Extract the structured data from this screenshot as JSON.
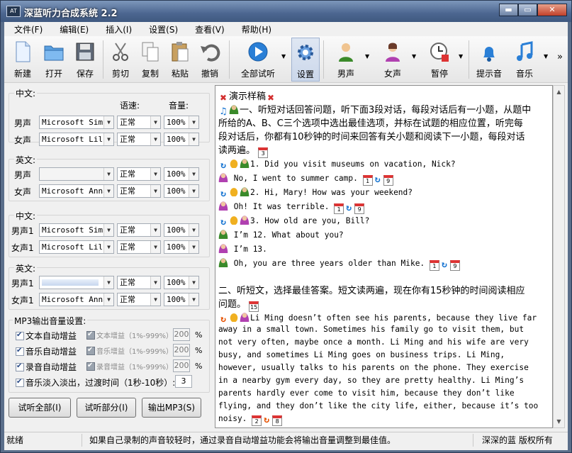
{
  "window": {
    "title": "深蓝听力合成系统 2.2",
    "min": "▬",
    "max": "▭",
    "close": "✕"
  },
  "menu": [
    "文件(F)",
    "编辑(E)",
    "插入(I)",
    "设置(S)",
    "查看(V)",
    "帮助(H)"
  ],
  "toolbar": {
    "new": "新建",
    "open": "打开",
    "save": "保存",
    "cut": "剪切",
    "copy": "复制",
    "paste": "粘贴",
    "undo": "撤销",
    "preview": "全部试听",
    "settings": "设置",
    "male": "男声",
    "female": "女声",
    "pause": "暂停",
    "cue": "提示音",
    "music": "音乐",
    "more": "»"
  },
  "voice": {
    "zh1": {
      "title": "中文:",
      "speed_head": "语速:",
      "vol_head": "音量:",
      "male_label": "男声",
      "female_label": "女声",
      "male_voice": "Microsoft Simp",
      "female_voice": "Microsoft Lili",
      "male_speed": "正常",
      "female_speed": "正常",
      "male_vol": "100%",
      "female_vol": "100%"
    },
    "en1": {
      "title": "英文:",
      "male_label": "男声",
      "female_label": "女声",
      "male_voice": "",
      "female_voice": "Microsoft Anna",
      "male_speed": "正常",
      "female_speed": "正常",
      "male_vol": "100%",
      "female_vol": "100%"
    },
    "zh2": {
      "title": "中文:",
      "male_label": "男声1",
      "female_label": "女声1",
      "male_voice": "Microsoft Simp",
      "female_voice": "Microsoft Lili",
      "male_speed": "正常",
      "female_speed": "正常",
      "male_vol": "100%",
      "female_vol": "100%"
    },
    "en2": {
      "title": "英文:",
      "male_label": "男声1",
      "female_label": "女声1",
      "male_voice": "",
      "female_voice": "Microsoft Anna",
      "male_speed": "正常",
      "female_speed": "正常",
      "male_vol": "100%",
      "female_vol": "100%"
    }
  },
  "mp3": {
    "title": "MP3输出音量设置:",
    "text_auto": "文本自动增益",
    "music_auto": "音乐自动增益",
    "rec_auto": "录音自动增益",
    "text_gain": "文本增益（1%-999%）",
    "music_gain": "音乐增益（1%-999%）",
    "rec_gain": "录音增益（1%-999%）",
    "text_val": "200",
    "music_val": "200",
    "rec_val": "200",
    "pct": "%",
    "fade": "音乐淡入淡出，过渡时间（1秒-10秒）:",
    "fade_val": "3"
  },
  "buttons": {
    "play_all": "试听全部(I)",
    "play_part": "试听部分(I)",
    "export": "输出MP3(S)"
  },
  "doc": {
    "title": "演示样稿",
    "p1": [
      "一、听短对话回答问题，听下面3段对话，每段对话后有一小题，从题中",
      "所给的A、B、C三个选项中选出最佳选项，并标在试题的相应位置，听完每",
      "段对话后，你都有10秒钟的时间来回答有关小题和阅读下一小题，每段对话",
      "读两遍。"
    ],
    "d1q": "1. Did you visit museums on vacation, Nick?",
    "d1a": "No, I went to summer camp.",
    "d2q": "2. Hi, Mary! How was your weekend?",
    "d2a": "Oh! It was terrible.",
    "d3q": "3. How old are you, Bill?",
    "d3a1": "I’m 12. What about you?",
    "d3a2": "I’m 13.",
    "d3a3": "Oh, you are three years older than Mike.",
    "p2": [
      "二、听短文，选择最佳答案。短文读两遍，现在你有15秒钟的时间阅读相应",
      "问题。"
    ],
    "passage": [
      "Li Ming doesn’t often see his parents, because they live far",
      "away in a small town. Sometimes his family go to visit them, but",
      "not very often, maybe once a month.  Li Ming and his wife are very",
      "busy, and sometimes Li Ming goes on business trips.  Li Ming,",
      "however, usually talks to his parents on the phone.  They exercise",
      "in a nearby gym every day, so they are pretty healthy.  Li Ming’s",
      "parents hardly ever come to visit him, because they don’t like",
      "flying, and they don’t like the city life, either, because it’s too",
      "noisy."
    ],
    "tags": {
      "t3": "3",
      "t1": "1",
      "t9": "9",
      "t15": "15",
      "t2": "2",
      "t8": "8"
    }
  },
  "status": {
    "left": "就绪",
    "mid": "如果自己录制的声音较轻时，通过录音自动增益功能会将输出音量调整到最佳值。",
    "right": "深深的蓝 版权所有"
  }
}
